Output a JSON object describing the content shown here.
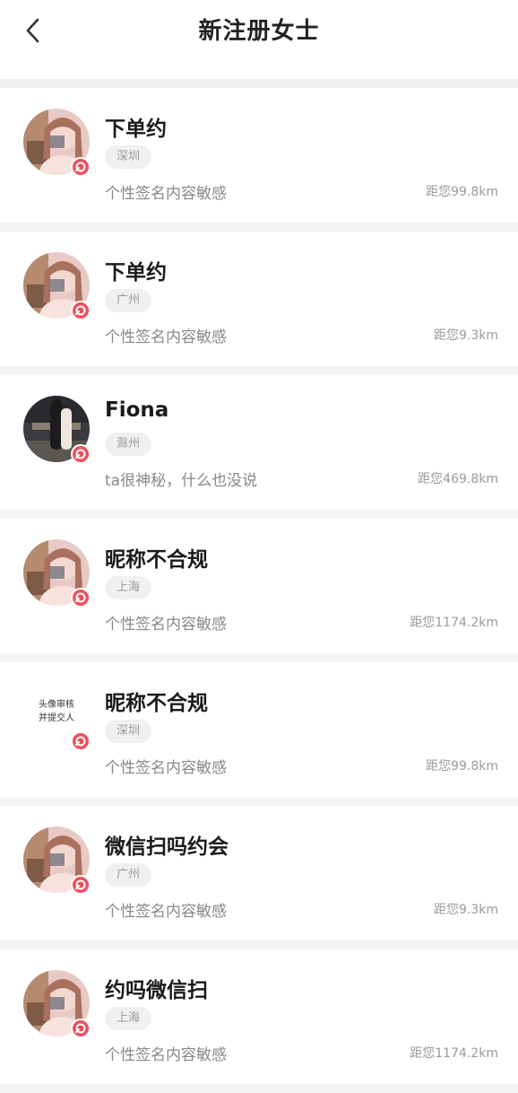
{
  "header": {
    "title": "新注册女士"
  },
  "users": [
    {
      "name": "下单约",
      "city": "深圳",
      "signature": "个性签名内容敏感",
      "distance": "距您99.8km",
      "avatar": "pink-girl"
    },
    {
      "name": "下单约",
      "city": "广州",
      "signature": "个性签名内容敏感",
      "distance": "距您9.3km",
      "avatar": "pink-girl"
    },
    {
      "name": "Fiona",
      "city": "滁州",
      "signature": "ta很神秘，什么也没说",
      "distance": "距您469.8km",
      "avatar": "dark-photo"
    },
    {
      "name": "昵称不合规",
      "city": "上海",
      "signature": "个性签名内容敏感",
      "distance": "距您1174.2km",
      "avatar": "pink-girl"
    },
    {
      "name": "昵称不合规",
      "city": "深圳",
      "signature": "个性签名内容敏感",
      "distance": "距您99.8km",
      "avatar": "text",
      "avatar_text": [
        "头像审核",
        "并提交人"
      ]
    },
    {
      "name": "微信扫吗约会",
      "city": "广州",
      "signature": "个性签名内容敏感",
      "distance": "距您9.3km",
      "avatar": "pink-girl"
    },
    {
      "name": "约吗微信扫",
      "city": "上海",
      "signature": "个性签名内容敏感",
      "distance": "距您1174.2km",
      "avatar": "pink-girl"
    }
  ],
  "colors": {
    "accent": "#f04e5e",
    "background": "#f4f4f6"
  }
}
